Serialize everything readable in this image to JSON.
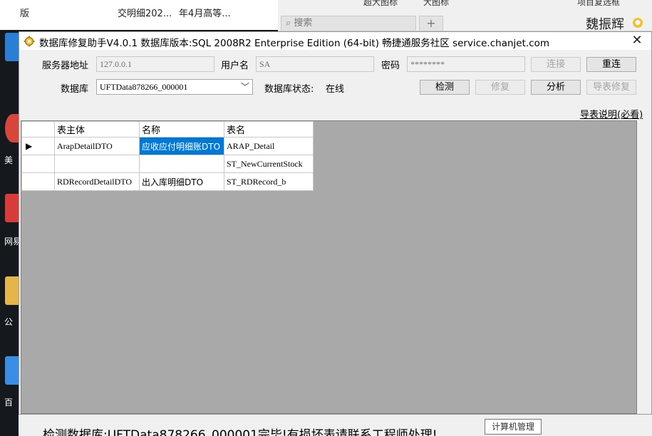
{
  "desktop": {
    "top_texts": [
      "版",
      "交明细202...",
      "年4月高等..."
    ],
    "search_placeholder": "搜索",
    "menu_large_icons": "超大图标",
    "menu_big_icons": "大图标",
    "menu_project": "项目复选框",
    "user_name": "魏振辉",
    "desktop_labels": [
      "美",
      "网易",
      "公",
      "百"
    ],
    "tooltip": "计算机管理"
  },
  "window": {
    "title": "数据库修复助手V4.0.1 数据库版本:SQL 2008R2 Enterprise Edition (64-bit) 畅捷通服务社区 service.chanjet.com",
    "close_glyph": "✕"
  },
  "form": {
    "server_label": "服务器地址",
    "server_value": "127.0.0.1",
    "user_label": "用户名",
    "user_value": "SA",
    "password_label": "密码",
    "password_value": "********",
    "connect_label": "连接",
    "reconnect_label": "重连",
    "db_label": "数据库",
    "db_value": "UFTData878266_000001",
    "db_status_label": "数据库状态:",
    "db_status_value": "在线",
    "detect_label": "检测",
    "repair_label": "修复",
    "analyze_label": "分析",
    "export_repair_label": "导表修复",
    "export_note_link": "导表说明(必看)"
  },
  "grid": {
    "columns": [
      "表主体",
      "名称",
      "表名"
    ],
    "current_row_marker": "▶",
    "rows": [
      {
        "entity": "ArapDetailDTO",
        "name": "应收应付明细账DTO",
        "table": "ARAP_Detail"
      },
      {
        "entity": "",
        "name": "",
        "table": "ST_NewCurrentStock"
      },
      {
        "entity": "RDRecordDetailDTO",
        "name": "出入库明细DTO",
        "table": "ST_RDRecord_b"
      }
    ]
  },
  "status_text": "检测数据库:UFTData878266_000001完毕!有损坏表请联系工程师处理!",
  "colors": {
    "selection": "#0078d7",
    "grid_background": "#a9a9a9",
    "window_background": "#f0f0f0"
  }
}
